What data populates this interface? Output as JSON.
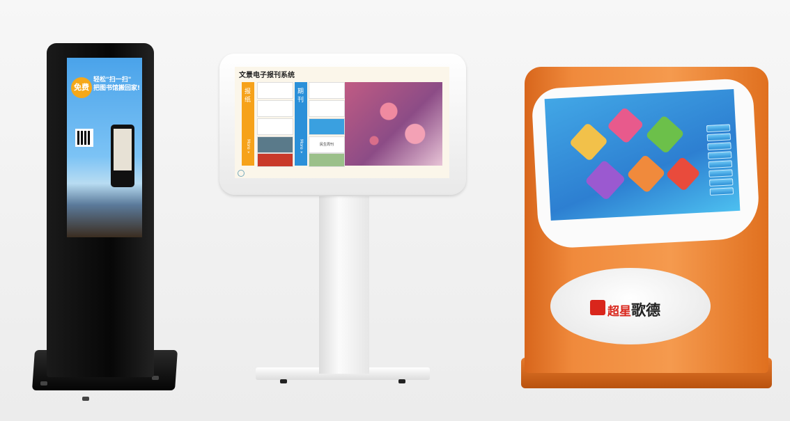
{
  "kiosk_left": {
    "badge": "免费",
    "headline_line1": "轻松\"扫一扫\"",
    "headline_line2": "把图书馆搬回家!"
  },
  "kiosk_center": {
    "app_title": "文景电子报刊系统",
    "column1_label": "报纸",
    "column1_more": "More »",
    "column2_label": "期刊",
    "column2_more": "More »",
    "thumbnail_label": "民生周刊"
  },
  "kiosk_right": {
    "brand_prefix": "超星",
    "brand_name": "歌德"
  },
  "colors": {
    "orange_body": "#f08a3c",
    "brand_red": "#d9261c",
    "panel_yellow": "#f6a21a",
    "panel_blue": "#2b90d9"
  }
}
